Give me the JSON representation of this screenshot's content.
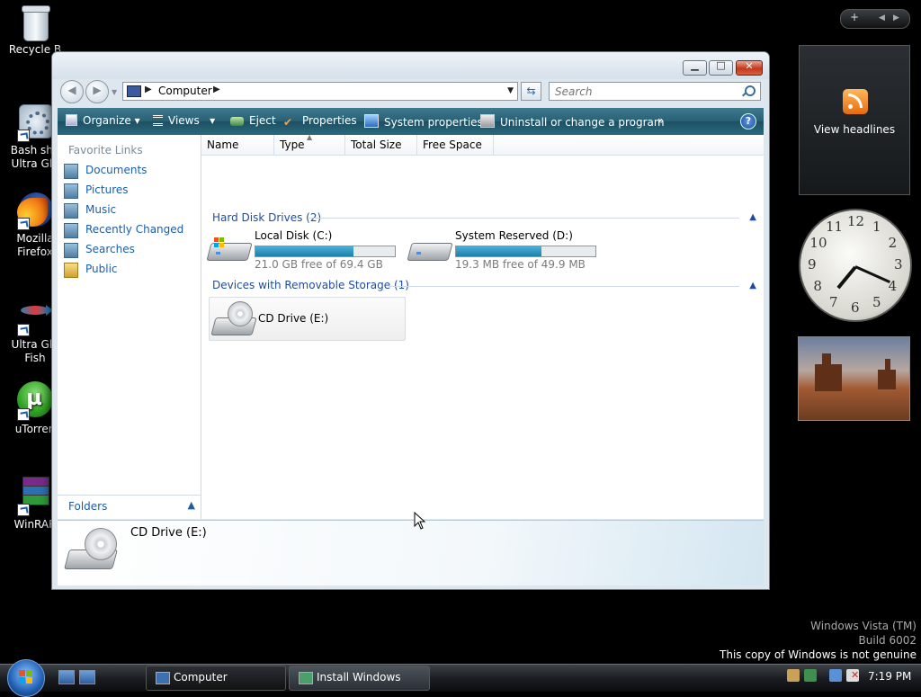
{
  "desktop": {
    "icons": [
      {
        "label": "Recycle B"
      },
      {
        "label": "Bash she\nUltra Gla"
      },
      {
        "label": "Mozilla\nFirefox"
      },
      {
        "label": "Ultra Gla\nFish"
      },
      {
        "label": "uTorren"
      },
      {
        "label": "WinRAR"
      }
    ]
  },
  "window": {
    "address": {
      "location": "Computer"
    },
    "search": {
      "placeholder": "Search"
    },
    "toolbar": {
      "organize": "Organize",
      "views": "Views",
      "eject": "Eject",
      "properties": "Properties",
      "system_properties": "System properties",
      "uninstall": "Uninstall or change a program",
      "more": "»"
    },
    "favorite_links": {
      "title": "Favorite Links",
      "items": [
        "Documents",
        "Pictures",
        "Music",
        "Recently Changed",
        "Searches",
        "Public"
      ]
    },
    "folders_label": "Folders",
    "columns": [
      "Name",
      "Type",
      "Total Size",
      "Free Space"
    ],
    "groups": {
      "hard_disks": "Hard Disk Drives (2)",
      "removable": "Devices with Removable Storage (1)"
    },
    "drives": [
      {
        "name": "Local Disk (C:)",
        "free_text": "21.0 GB free of 69.4 GB",
        "used_fraction": 0.7
      },
      {
        "name": "System Reserved (D:)",
        "free_text": "19.3 MB free of 49.9 MB",
        "used_fraction": 0.61
      }
    ],
    "cd_drive": {
      "name": "CD Drive (E:)"
    },
    "details": {
      "name": "CD Drive (E:)"
    }
  },
  "gadgets": {
    "feed_label": "View headlines",
    "clock_numbers": [
      "12",
      "1",
      "2",
      "3",
      "4",
      "5",
      "6",
      "7",
      "8",
      "9",
      "10",
      "11"
    ],
    "clock_time": {
      "hour": 7,
      "minute": 19
    }
  },
  "watermark": {
    "line1": "Windows Vista (TM)",
    "line2": "Build 6002",
    "line3": "This copy of Windows is not genuine"
  },
  "taskbar": {
    "tasks": [
      "Computer",
      "Install Windows"
    ],
    "clock": "7:19 PM"
  },
  "colors": {
    "accent": "#1c5daa",
    "toolbar": "#285f74",
    "progress": "#1d7fab"
  }
}
